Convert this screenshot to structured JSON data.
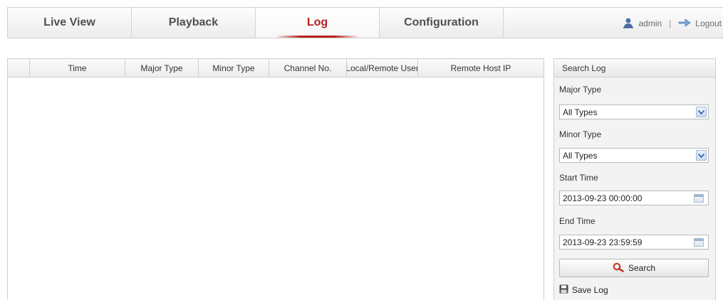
{
  "nav": {
    "tabs": [
      {
        "label": "Live View"
      },
      {
        "label": "Playback"
      },
      {
        "label": "Log"
      },
      {
        "label": "Configuration"
      }
    ],
    "active_tab": "Log",
    "user": "admin",
    "separator": "|",
    "logout_label": "Logout"
  },
  "table": {
    "columns": [
      "",
      "Time",
      "Major Type",
      "Minor Type",
      "Channel No.",
      "Local/Remote User",
      "Remote Host IP"
    ],
    "rows": []
  },
  "search_panel": {
    "title": "Search Log",
    "major_type_label": "Major Type",
    "major_type_value": "All Types",
    "minor_type_label": "Minor Type",
    "minor_type_value": "All Types",
    "start_time_label": "Start Time",
    "start_time_value": "2013-09-23 00:00:00",
    "end_time_label": "End Time",
    "end_time_value": "2013-09-23 23:59:59",
    "search_label": "Search",
    "save_log_label": "Save Log"
  },
  "icons": {
    "user": "user-icon",
    "logout": "logout-icon",
    "dropdown": "chevron-down-icon",
    "calendar": "calendar-icon",
    "search": "search-icon",
    "save": "save-icon"
  },
  "colors": {
    "accent": "#b8211f",
    "search_icon": "#c0392b",
    "user_icon": "#4a6fa5"
  }
}
